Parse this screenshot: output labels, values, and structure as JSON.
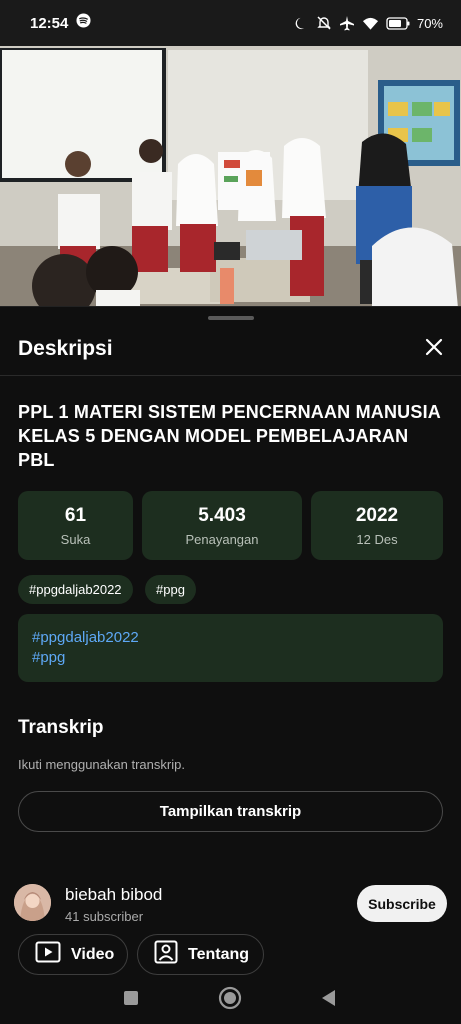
{
  "status_bar": {
    "time": "12:54",
    "battery_percent": "70%",
    "icons": [
      "spotify-icon",
      "moon-icon",
      "mute-icon",
      "airplane-icon",
      "wifi-icon",
      "battery-icon"
    ]
  },
  "sheet": {
    "title": "Deskripsi",
    "video_title": "PPL 1 MATERI SISTEM PENCERNAAN MANUSIA KELAS 5 DENGAN MODEL PEMBELAJARAN PBL",
    "stats": [
      {
        "value": "61",
        "label": "Suka"
      },
      {
        "value": "5.403",
        "label": "Penayangan"
      },
      {
        "value": "2022",
        "label": "12 Des"
      }
    ],
    "tags": [
      "#ppgdaljab2022",
      "#ppg"
    ],
    "description_lines": [
      "#ppgdaljab2022",
      "#ppg"
    ],
    "transcript": {
      "title": "Transkrip",
      "hint": "Ikuti menggunakan transkrip.",
      "button": "Tampilkan transkrip"
    },
    "channel": {
      "name": "biebah bibod",
      "subscribers": "41 subscriber",
      "subscribe_label": "Subscribe"
    },
    "buttons": {
      "video": "Video",
      "about": "Tentang"
    }
  },
  "colors": {
    "background": "#0f0f0f",
    "card": "#1d2e1f",
    "link": "#5ea8f5"
  }
}
